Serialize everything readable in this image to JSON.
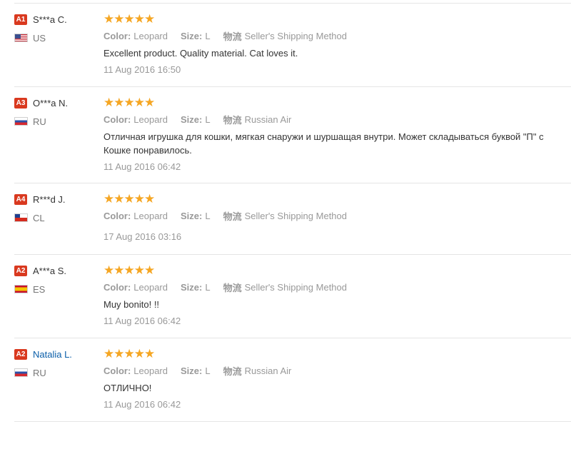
{
  "labels": {
    "color": "Color:",
    "size": "Size:",
    "logistics": "物流"
  },
  "star_color": "#f5a623",
  "badge_color": "#d9391f",
  "reviews": [
    {
      "level": "A1",
      "name": "S***a C.",
      "country_code": "US",
      "flag_icon": "us-flag-icon",
      "rating": 5,
      "color": "Leopard",
      "size": "L",
      "shipping": "Seller's Shipping Method",
      "text": "Excellent product. Quality material. Cat loves it.",
      "date": "11 Aug 2016 16:50"
    },
    {
      "level": "A3",
      "name": "O***a N.",
      "country_code": "RU",
      "flag_icon": "ru-flag-icon",
      "rating": 5,
      "color": "Leopard",
      "size": "L",
      "shipping": "Russian Air",
      "text": "Отличная игрушка для кошки, мягкая снаружи и шуршащая внутри. Может складываться буквой \"П\" с Кошке понравилось.",
      "text_line1": "Отличная игрушка для кошки, мягкая снаружи и шуршащая внутри. Может складываться буквой \"П\" с",
      "text_line2": "Кошке понравилось.",
      "date": "11 Aug 2016 06:42"
    },
    {
      "level": "A4",
      "name": "R***d J.",
      "country_code": "CL",
      "flag_icon": "cl-flag-icon",
      "rating": 5,
      "color": "Leopard",
      "size": "L",
      "shipping": "Seller's Shipping Method",
      "text": "",
      "date": "17 Aug 2016 03:16"
    },
    {
      "level": "A2",
      "name": "A***a S.",
      "country_code": "ES",
      "flag_icon": "es-flag-icon",
      "rating": 5,
      "color": "Leopard",
      "size": "L",
      "shipping": "Seller's Shipping Method",
      "text": "Muy bonito! !!",
      "date": "11 Aug 2016 06:42"
    },
    {
      "level": "A2",
      "name": "Natalia L.",
      "country_code": "RU",
      "flag_icon": "ru-flag-icon",
      "rating": 5,
      "color": "Leopard",
      "size": "L",
      "shipping": "Russian Air",
      "text": "ОТЛИЧНО!",
      "date": "11 Aug 2016 06:42"
    }
  ]
}
